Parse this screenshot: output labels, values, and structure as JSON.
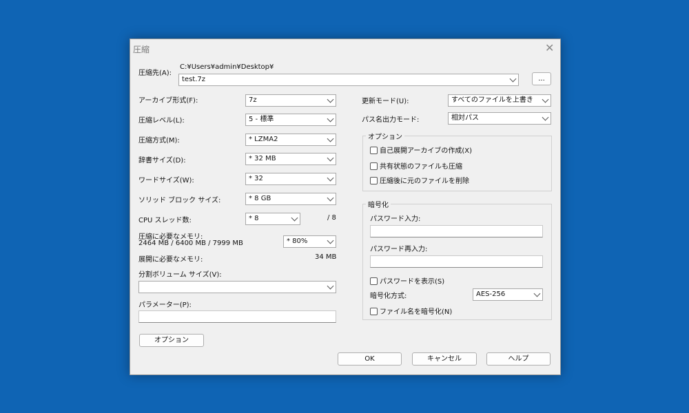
{
  "window": {
    "title": "圧縮",
    "close_glyph": "✕"
  },
  "archive": {
    "label": "圧縮先(A):",
    "path": "C:¥Users¥admin¥Desktop¥",
    "filename": "test.7z",
    "browse_label": "..."
  },
  "left": {
    "format": {
      "label": "アーカイブ形式(F):",
      "value": "7z"
    },
    "level": {
      "label": "圧縮レベル(L):",
      "value": "5 - 標準"
    },
    "method": {
      "label": "圧縮方式(M):",
      "value": "*  LZMA2"
    },
    "dict": {
      "label": "辞書サイズ(D):",
      "value": "*  32 MB"
    },
    "word": {
      "label": "ワードサイズ(W):",
      "value": "*  32"
    },
    "solid": {
      "label": "ソリッド ブロック サイズ:",
      "value": "*  8 GB"
    },
    "cpu": {
      "label": "CPU スレッド数:",
      "value": "*  8",
      "total": "/ 8"
    },
    "mem_compress": {
      "label": "圧縮に必要なメモリ:",
      "detail": "2464 MB / 6400 MB / 7999 MB",
      "value": "*  80%"
    },
    "mem_extract": {
      "label": "展開に必要なメモリ:",
      "value": "34 MB"
    },
    "split": {
      "label": "分割ボリューム サイズ(V):",
      "value": ""
    },
    "params": {
      "label": "パラメーター(P):",
      "value": ""
    },
    "options_button": "オプション"
  },
  "right": {
    "update_mode": {
      "label": "更新モード(U):",
      "value": "すべてのファイルを上書き"
    },
    "path_mode": {
      "label": "パス名出力モード:",
      "value": "相対パス"
    },
    "options_group": {
      "title": "オプション",
      "sfx": "自己展開アーカイブの作成(X)",
      "shared": "共有状態のファイルも圧縮",
      "delete": "圧縮後に元のファイルを削除"
    },
    "encryption": {
      "title": "暗号化",
      "password_label": "パスワード入力:",
      "password_value": "",
      "reenter_label": "パスワード再入力:",
      "reenter_value": "",
      "show_password": "パスワードを表示(S)",
      "method_label": "暗号化方式:",
      "method_value": "AES-256",
      "encrypt_names": "ファイル名を暗号化(N)"
    }
  },
  "buttons": {
    "ok": "OK",
    "cancel": "キャンセル",
    "help": "ヘルプ"
  }
}
